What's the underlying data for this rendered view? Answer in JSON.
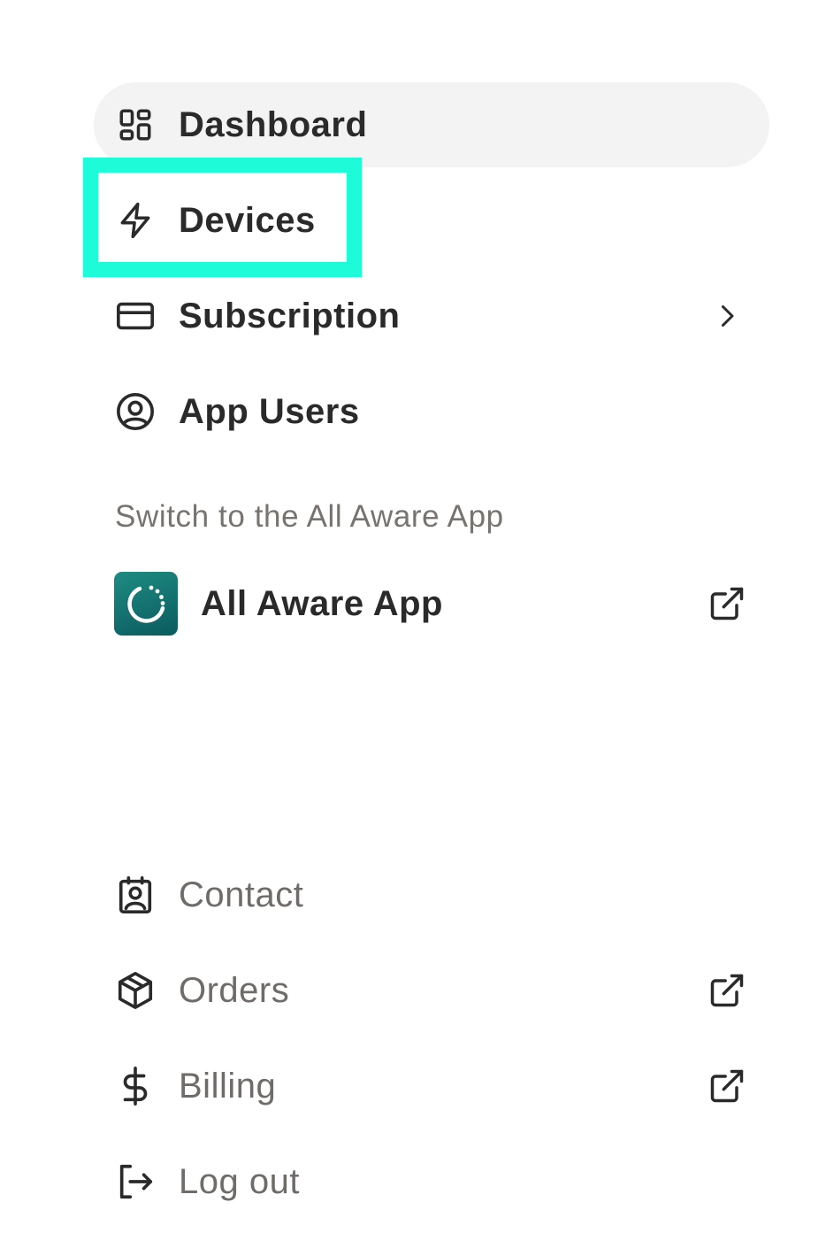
{
  "menu": {
    "primary_items": [
      {
        "label": "Dashboard",
        "icon": "grid-icon",
        "active": true
      },
      {
        "label": "Devices",
        "icon": "lightning-icon",
        "highlighted": true
      },
      {
        "label": "Subscription",
        "icon": "credit-card-icon",
        "trailing_icon": "chevron-right-icon"
      },
      {
        "label": "App Users",
        "icon": "user-circle-icon"
      }
    ],
    "switch_caption": "Switch to the All Aware App",
    "app_link": {
      "label": "All Aware App",
      "icon": "all-aware-logo",
      "trailing_icon": "external-link-icon"
    },
    "secondary_items": [
      {
        "label": "Contact",
        "icon": "contact-card-icon"
      },
      {
        "label": "Orders",
        "icon": "package-icon",
        "trailing_icon": "external-link-icon"
      },
      {
        "label": "Billing",
        "icon": "dollar-icon",
        "trailing_icon": "external-link-icon"
      },
      {
        "label": "Log out",
        "icon": "logout-icon"
      }
    ]
  },
  "colors": {
    "active_background": "#f3f3f3",
    "highlight_outline": "#1dfbd9",
    "primary_text": "#2a2a2a",
    "secondary_text": "#6e6b68",
    "app_logo": "#0b5a5e"
  }
}
